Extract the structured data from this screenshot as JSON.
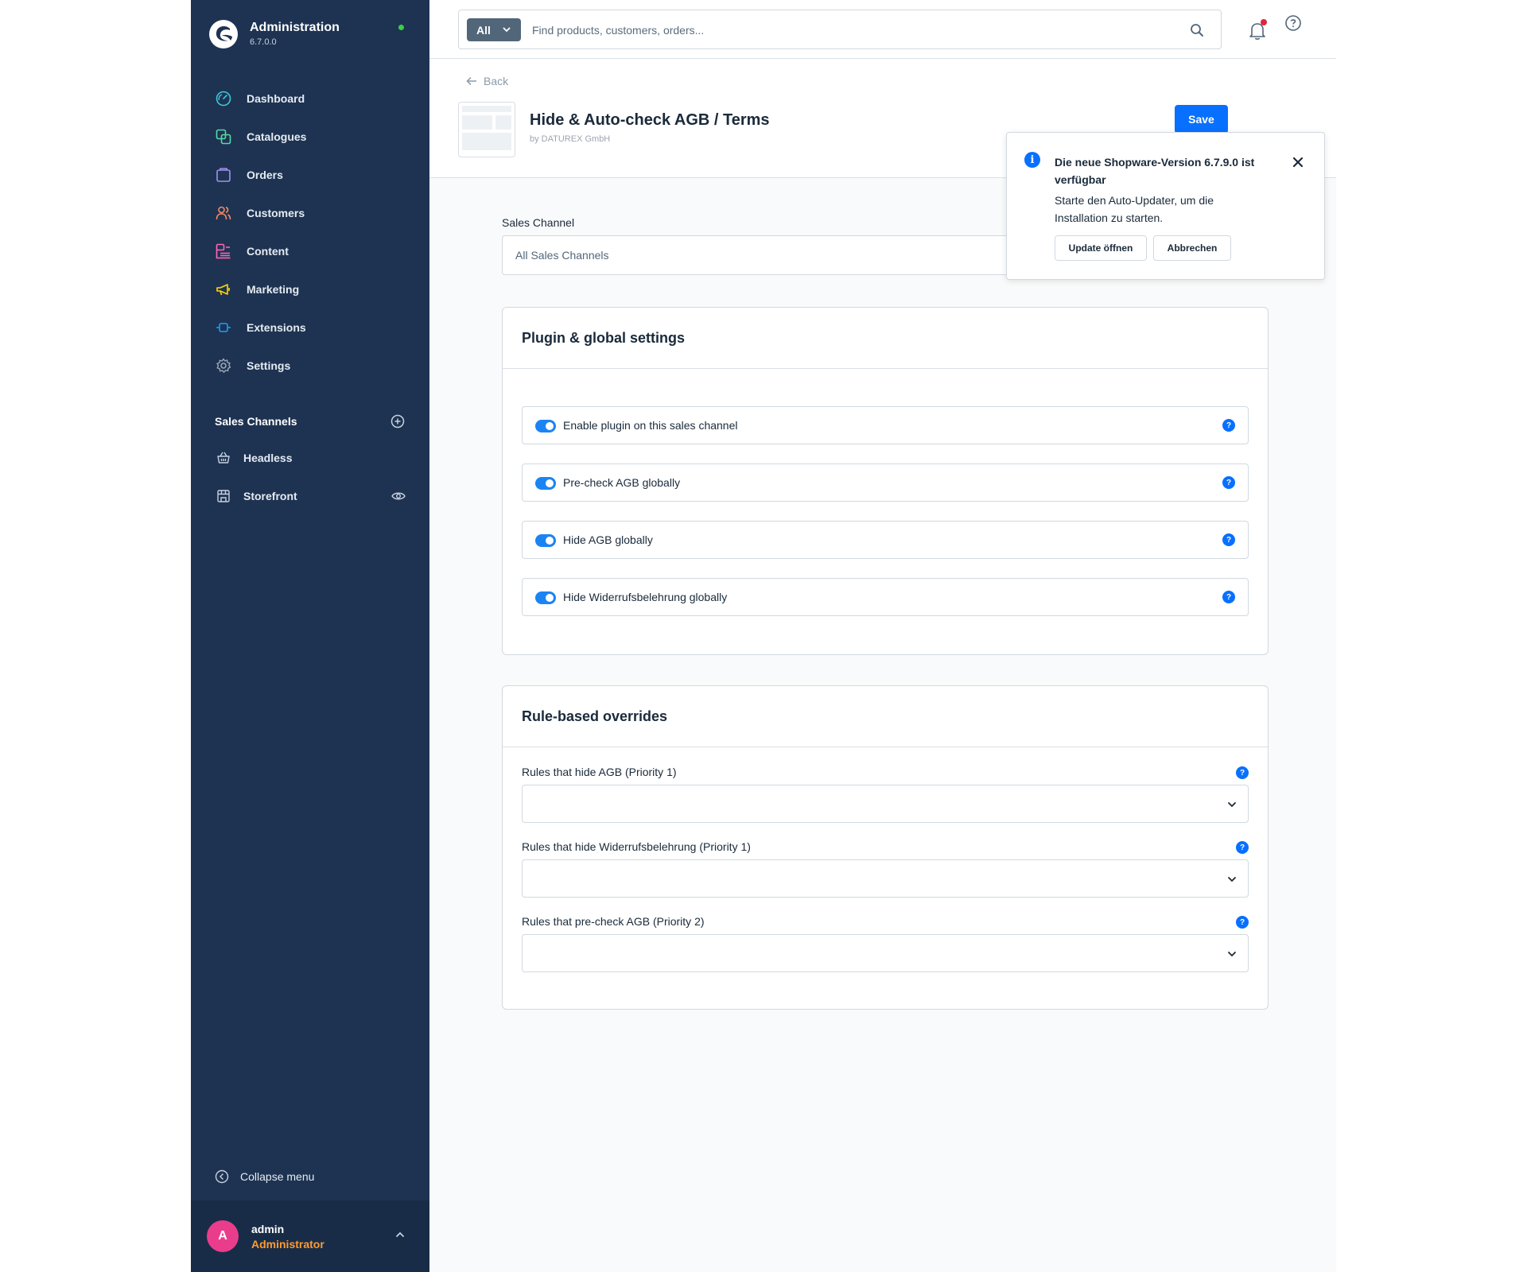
{
  "sidebar": {
    "title": "Administration",
    "version": "6.7.0.0",
    "nav": [
      {
        "label": "Dashboard",
        "icon": "dashboard-icon",
        "color": "#3bc7d9"
      },
      {
        "label": "Catalogues",
        "icon": "catalogue-icon",
        "color": "#57d9a3"
      },
      {
        "label": "Orders",
        "icon": "orders-icon",
        "color": "#a092f0"
      },
      {
        "label": "Customers",
        "icon": "customers-icon",
        "color": "#f88962"
      },
      {
        "label": "Content",
        "icon": "content-icon",
        "color": "#ff68b4"
      },
      {
        "label": "Marketing",
        "icon": "marketing-icon",
        "color": "#ffd700"
      },
      {
        "label": "Extensions",
        "icon": "extensions-icon",
        "color": "#189eff"
      },
      {
        "label": "Settings",
        "icon": "settings-icon",
        "color": "#9aa8b5"
      }
    ],
    "sales_channels_title": "Sales Channels",
    "sales_channels": [
      {
        "label": "Headless",
        "icon": "basket-icon"
      },
      {
        "label": "Storefront",
        "icon": "storefront-icon"
      }
    ],
    "collapse_label": "Collapse menu",
    "user": {
      "initial": "A",
      "name": "admin",
      "role": "Administrator"
    }
  },
  "topbar": {
    "search_type": "All",
    "search_placeholder": "Find products, customers, orders..."
  },
  "header": {
    "back_label": "Back",
    "title": "Hide & Auto-check AGB / Terms",
    "subtitle": "by DATUREX GmbH",
    "save_label": "Save"
  },
  "sales_channel": {
    "label": "Sales Channel",
    "value": "All Sales Channels"
  },
  "global_settings": {
    "title": "Plugin & global settings",
    "toggles": [
      {
        "label": "Enable plugin on this sales channel",
        "enabled": true
      },
      {
        "label": "Pre-check AGB globally",
        "enabled": true
      },
      {
        "label": "Hide AGB globally",
        "enabled": true
      },
      {
        "label": "Hide Widerrufsbelehrung globally",
        "enabled": true
      }
    ]
  },
  "rule_overrides": {
    "title": "Rule-based overrides",
    "rules": [
      {
        "label": "Rules that hide AGB (Priority 1)",
        "value": ""
      },
      {
        "label": "Rules that hide Widerrufsbelehrung (Priority 1)",
        "value": ""
      },
      {
        "label": "Rules that pre-check AGB (Priority 2)",
        "value": ""
      }
    ]
  },
  "notification": {
    "title": "Die neue Shopware-Version 6.7.9.0 ist verfügbar",
    "text": "Starte den Auto-Updater, um die Installation zu starten.",
    "primary_label": "Update öffnen",
    "secondary_label": "Abbrechen"
  },
  "colors": {
    "sidebar_bg": "#1e3352",
    "accent": "#0870ff",
    "status_online": "#37d046",
    "user_role": "#ff9b2f",
    "avatar": "#e93d8c"
  }
}
